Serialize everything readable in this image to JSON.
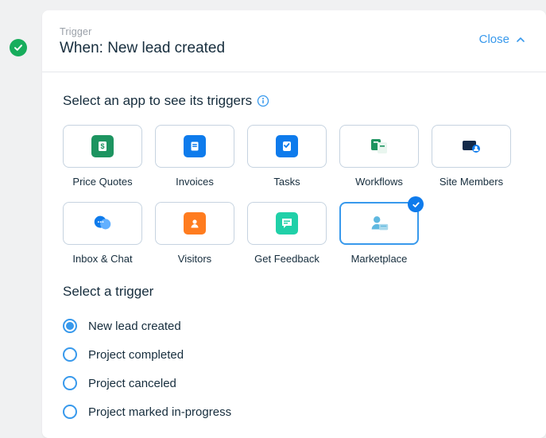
{
  "header": {
    "kicker": "Trigger",
    "title": "When: New lead created",
    "close_label": "Close"
  },
  "select_app_section": {
    "title": "Select an app to see its triggers"
  },
  "apps": [
    {
      "label": "Price Quotes"
    },
    {
      "label": "Invoices"
    },
    {
      "label": "Tasks"
    },
    {
      "label": "Workflows"
    },
    {
      "label": "Site Members"
    },
    {
      "label": "Inbox & Chat"
    },
    {
      "label": "Visitors"
    },
    {
      "label": "Get Feedback"
    },
    {
      "label": "Marketplace"
    }
  ],
  "selected_app_index": 8,
  "trigger_section": {
    "title": "Select a trigger"
  },
  "triggers": [
    {
      "label": "New lead created",
      "selected": true
    },
    {
      "label": "Project completed",
      "selected": false
    },
    {
      "label": "Project canceled",
      "selected": false
    },
    {
      "label": "Project marked in-progress",
      "selected": false
    }
  ]
}
